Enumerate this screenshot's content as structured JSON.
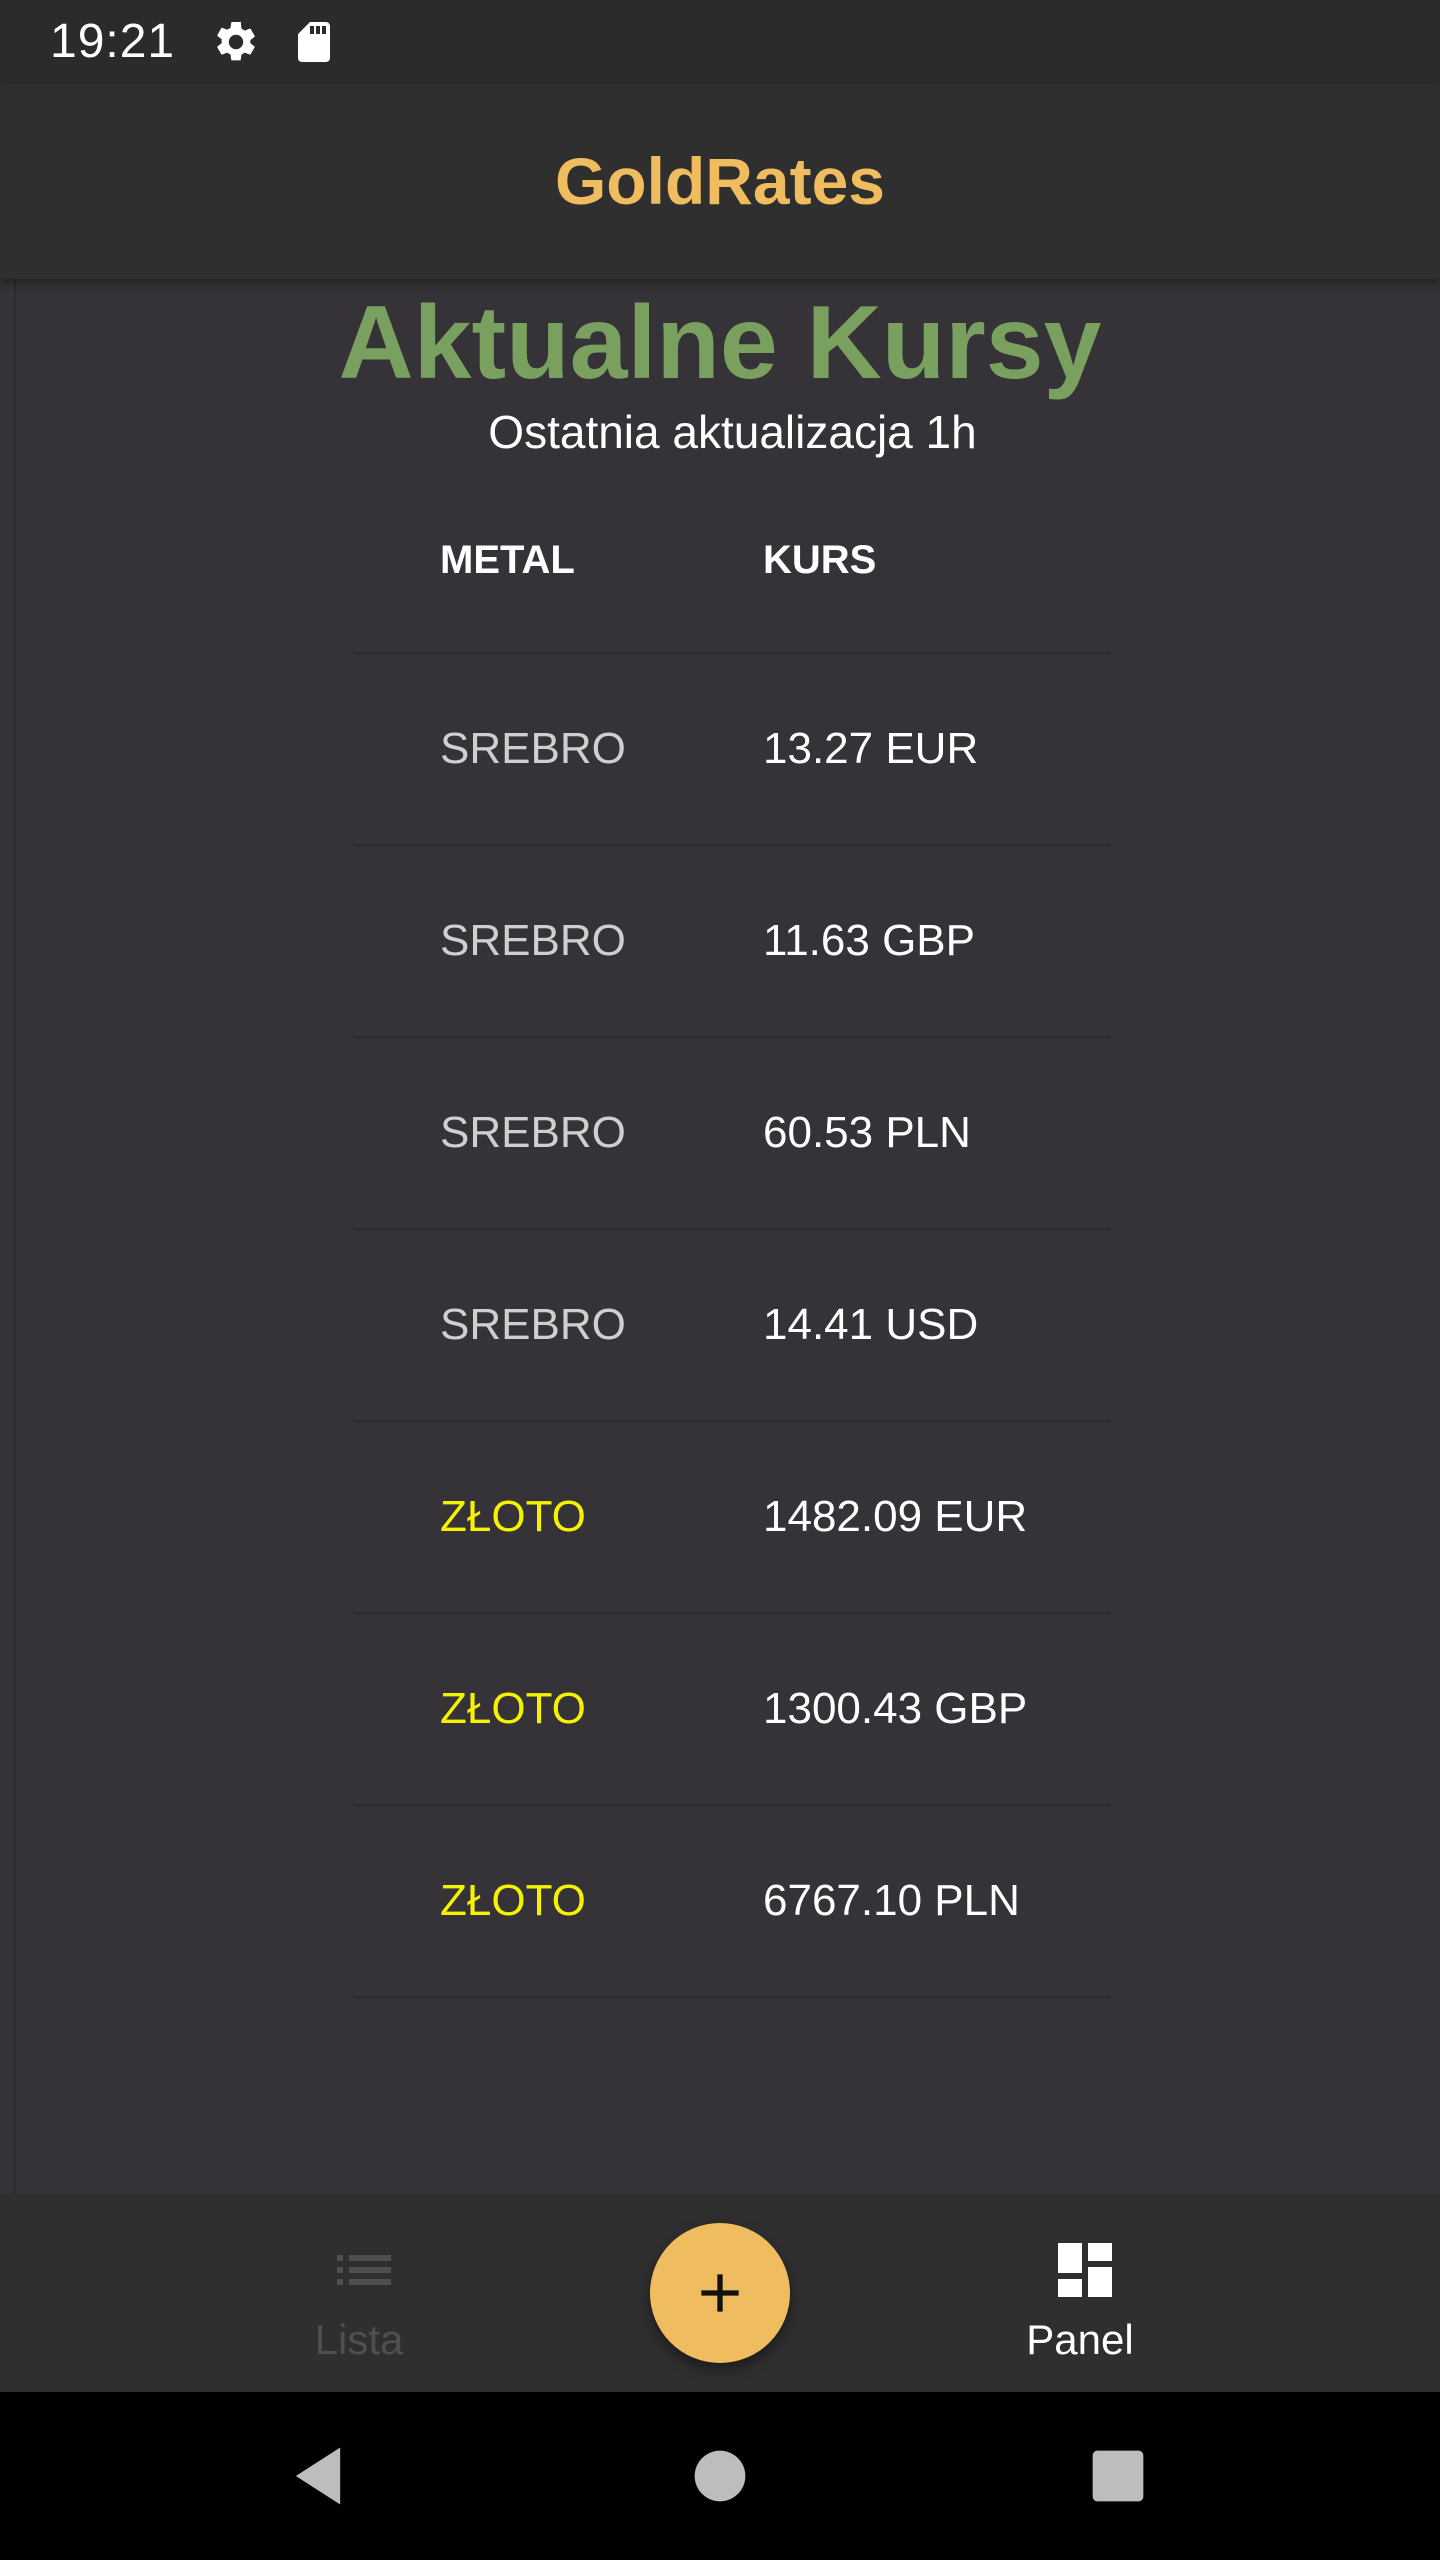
{
  "status_bar": {
    "time": "19:21",
    "icons": [
      "gear-icon",
      "sd-card-icon"
    ]
  },
  "app_bar": {
    "title": "GoldRates",
    "title_color": "#efbd5f"
  },
  "main": {
    "title": "Aktualne Kursy",
    "title_color": "#79a05f",
    "subtitle": "Ostatnia aktualizacja 1h",
    "table": {
      "headers": {
        "metal": "METAL",
        "rate": "KURS"
      },
      "rows": [
        {
          "metal": "SREBRO",
          "rate": "13.27 EUR",
          "kind": "silver"
        },
        {
          "metal": "SREBRO",
          "rate": "11.63 GBP",
          "kind": "silver"
        },
        {
          "metal": "SREBRO",
          "rate": "60.53 PLN",
          "kind": "silver"
        },
        {
          "metal": "SREBRO",
          "rate": "14.41 USD",
          "kind": "silver"
        },
        {
          "metal": "ZŁOTO",
          "rate": "1482.09 EUR",
          "kind": "gold"
        },
        {
          "metal": "ZŁOTO",
          "rate": "1300.43 GBP",
          "kind": "gold"
        },
        {
          "metal": "ZŁOTO",
          "rate": "6767.10 PLN",
          "kind": "gold"
        }
      ],
      "colors": {
        "silver": "#cfcfcf",
        "gold": "#f5f200"
      }
    }
  },
  "bottom_nav": {
    "items": [
      {
        "label": "Lista",
        "icon": "list-icon",
        "active": false
      },
      {
        "label": "Panel",
        "icon": "dashboard-icon",
        "active": true
      }
    ],
    "fab": {
      "icon": "plus-icon",
      "color": "#efbd5f"
    }
  },
  "system_nav": {
    "buttons": [
      "back-icon",
      "home-icon",
      "recents-icon"
    ]
  }
}
